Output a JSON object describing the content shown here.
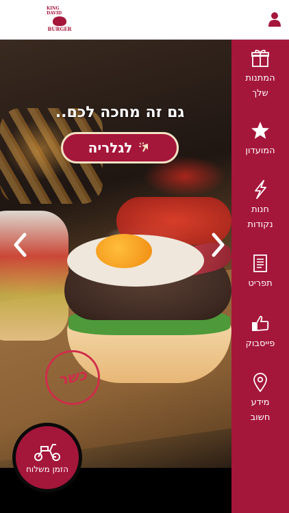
{
  "header": {
    "logo_top": "KING DAVID",
    "logo_bottom": "BURGER",
    "user_icon": "user-icon"
  },
  "hero": {
    "headline": "גם זה מחכה לכם..",
    "gallery_button": "לגלריה",
    "kosher_stamp": "כשר"
  },
  "delivery_button": {
    "label": "הזמן משלוח",
    "icon": "scooter-icon"
  },
  "sidebar": {
    "items": [
      {
        "label_line1": "המתנות",
        "label_line2": "שלך",
        "icon": "gift-icon"
      },
      {
        "label_line1": "המועדון",
        "label_line2": "",
        "icon": "star-icon"
      },
      {
        "label_line1": "חנות",
        "label_line2": "נקודות",
        "icon": "lightning-icon"
      },
      {
        "label_line1": "תפריט",
        "label_line2": "",
        "icon": "menu-icon"
      },
      {
        "label_line1": "פייסבוק",
        "label_line2": "",
        "icon": "thumbs-up-icon"
      },
      {
        "label_line1": "מידע",
        "label_line2": "חשוב",
        "icon": "location-pin-icon"
      }
    ]
  },
  "colors": {
    "brand": "#a5163b",
    "header_bg": "#ffffff",
    "button_border": "#f3e2c4"
  }
}
